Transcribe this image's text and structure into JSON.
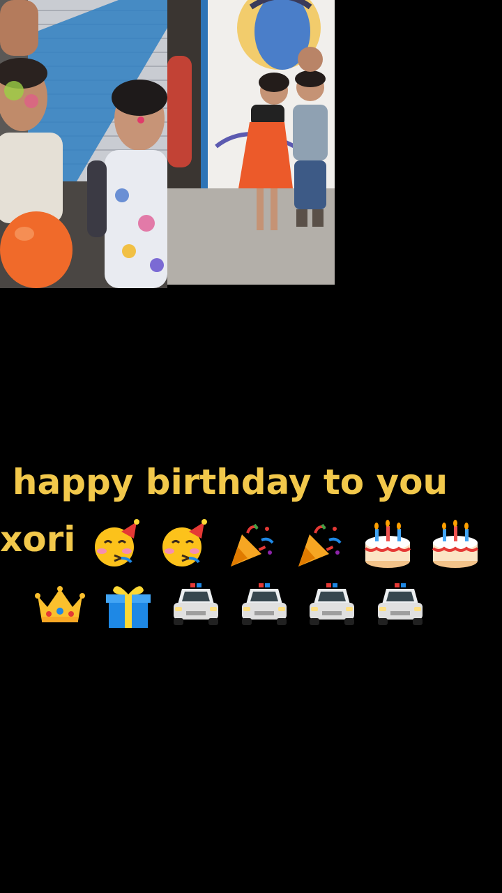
{
  "caption": {
    "line1": "happy birthday to you",
    "line2_text": "xori",
    "line2_emoji": [
      "party-face",
      "party-face",
      "party-popper",
      "party-popper",
      "birthday-cake",
      "birthday-cake"
    ],
    "line3_emoji": [
      "crown",
      "wrapped-gift",
      "police-car",
      "police-car",
      "police-car",
      "police-car"
    ]
  },
  "colors": {
    "background": "#000000",
    "caption_text": "#f2c84b"
  },
  "photos": [
    "left-photo-kids-with-balloon",
    "right-photo-two-kids-by-wall"
  ]
}
